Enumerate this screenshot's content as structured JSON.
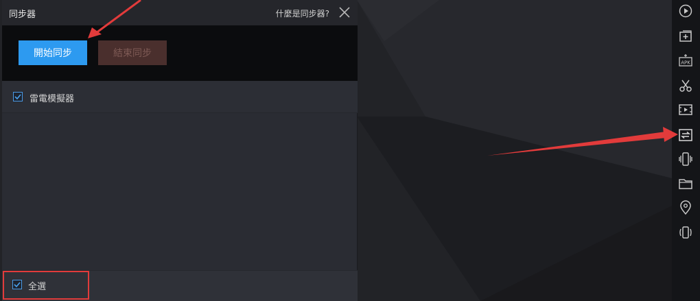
{
  "dialog": {
    "title": "同步器",
    "help_link": "什麼是同步器?",
    "start_button": "開始同步",
    "stop_button": "結束同步",
    "emulator_item": "雷電模擬器",
    "select_all": "全選"
  },
  "toolbar": {
    "icons": [
      "play-circle-icon",
      "add-window-icon",
      "apk-install-icon",
      "scissors-icon",
      "video-record-icon",
      "sync-icon",
      "shake-icon",
      "folder-icon",
      "location-pin-icon",
      "rotate-screen-icon"
    ],
    "apk_icon_text": "APK"
  },
  "colors": {
    "accent_blue": "#2d9af0",
    "stop_button_bg": "#4a2f2d",
    "annotation_red": "#e23b3b"
  }
}
